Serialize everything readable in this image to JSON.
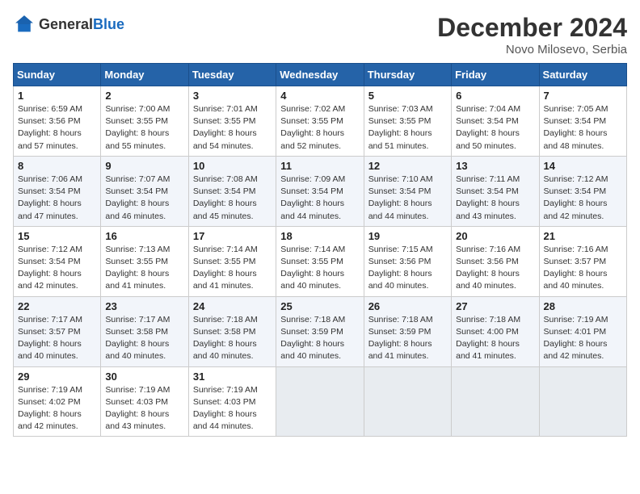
{
  "header": {
    "logo_general": "General",
    "logo_blue": "Blue",
    "month": "December 2024",
    "location": "Novo Milosevo, Serbia"
  },
  "weekdays": [
    "Sunday",
    "Monday",
    "Tuesday",
    "Wednesday",
    "Thursday",
    "Friday",
    "Saturday"
  ],
  "weeks": [
    [
      {
        "day": "1",
        "info": "Sunrise: 6:59 AM\nSunset: 3:56 PM\nDaylight: 8 hours\nand 57 minutes."
      },
      {
        "day": "2",
        "info": "Sunrise: 7:00 AM\nSunset: 3:55 PM\nDaylight: 8 hours\nand 55 minutes."
      },
      {
        "day": "3",
        "info": "Sunrise: 7:01 AM\nSunset: 3:55 PM\nDaylight: 8 hours\nand 54 minutes."
      },
      {
        "day": "4",
        "info": "Sunrise: 7:02 AM\nSunset: 3:55 PM\nDaylight: 8 hours\nand 52 minutes."
      },
      {
        "day": "5",
        "info": "Sunrise: 7:03 AM\nSunset: 3:55 PM\nDaylight: 8 hours\nand 51 minutes."
      },
      {
        "day": "6",
        "info": "Sunrise: 7:04 AM\nSunset: 3:54 PM\nDaylight: 8 hours\nand 50 minutes."
      },
      {
        "day": "7",
        "info": "Sunrise: 7:05 AM\nSunset: 3:54 PM\nDaylight: 8 hours\nand 48 minutes."
      }
    ],
    [
      {
        "day": "8",
        "info": "Sunrise: 7:06 AM\nSunset: 3:54 PM\nDaylight: 8 hours\nand 47 minutes."
      },
      {
        "day": "9",
        "info": "Sunrise: 7:07 AM\nSunset: 3:54 PM\nDaylight: 8 hours\nand 46 minutes."
      },
      {
        "day": "10",
        "info": "Sunrise: 7:08 AM\nSunset: 3:54 PM\nDaylight: 8 hours\nand 45 minutes."
      },
      {
        "day": "11",
        "info": "Sunrise: 7:09 AM\nSunset: 3:54 PM\nDaylight: 8 hours\nand 44 minutes."
      },
      {
        "day": "12",
        "info": "Sunrise: 7:10 AM\nSunset: 3:54 PM\nDaylight: 8 hours\nand 44 minutes."
      },
      {
        "day": "13",
        "info": "Sunrise: 7:11 AM\nSunset: 3:54 PM\nDaylight: 8 hours\nand 43 minutes."
      },
      {
        "day": "14",
        "info": "Sunrise: 7:12 AM\nSunset: 3:54 PM\nDaylight: 8 hours\nand 42 minutes."
      }
    ],
    [
      {
        "day": "15",
        "info": "Sunrise: 7:12 AM\nSunset: 3:54 PM\nDaylight: 8 hours\nand 42 minutes."
      },
      {
        "day": "16",
        "info": "Sunrise: 7:13 AM\nSunset: 3:55 PM\nDaylight: 8 hours\nand 41 minutes."
      },
      {
        "day": "17",
        "info": "Sunrise: 7:14 AM\nSunset: 3:55 PM\nDaylight: 8 hours\nand 41 minutes."
      },
      {
        "day": "18",
        "info": "Sunrise: 7:14 AM\nSunset: 3:55 PM\nDaylight: 8 hours\nand 40 minutes."
      },
      {
        "day": "19",
        "info": "Sunrise: 7:15 AM\nSunset: 3:56 PM\nDaylight: 8 hours\nand 40 minutes."
      },
      {
        "day": "20",
        "info": "Sunrise: 7:16 AM\nSunset: 3:56 PM\nDaylight: 8 hours\nand 40 minutes."
      },
      {
        "day": "21",
        "info": "Sunrise: 7:16 AM\nSunset: 3:57 PM\nDaylight: 8 hours\nand 40 minutes."
      }
    ],
    [
      {
        "day": "22",
        "info": "Sunrise: 7:17 AM\nSunset: 3:57 PM\nDaylight: 8 hours\nand 40 minutes."
      },
      {
        "day": "23",
        "info": "Sunrise: 7:17 AM\nSunset: 3:58 PM\nDaylight: 8 hours\nand 40 minutes."
      },
      {
        "day": "24",
        "info": "Sunrise: 7:18 AM\nSunset: 3:58 PM\nDaylight: 8 hours\nand 40 minutes."
      },
      {
        "day": "25",
        "info": "Sunrise: 7:18 AM\nSunset: 3:59 PM\nDaylight: 8 hours\nand 40 minutes."
      },
      {
        "day": "26",
        "info": "Sunrise: 7:18 AM\nSunset: 3:59 PM\nDaylight: 8 hours\nand 41 minutes."
      },
      {
        "day": "27",
        "info": "Sunrise: 7:18 AM\nSunset: 4:00 PM\nDaylight: 8 hours\nand 41 minutes."
      },
      {
        "day": "28",
        "info": "Sunrise: 7:19 AM\nSunset: 4:01 PM\nDaylight: 8 hours\nand 42 minutes."
      }
    ],
    [
      {
        "day": "29",
        "info": "Sunrise: 7:19 AM\nSunset: 4:02 PM\nDaylight: 8 hours\nand 42 minutes."
      },
      {
        "day": "30",
        "info": "Sunrise: 7:19 AM\nSunset: 4:03 PM\nDaylight: 8 hours\nand 43 minutes."
      },
      {
        "day": "31",
        "info": "Sunrise: 7:19 AM\nSunset: 4:03 PM\nDaylight: 8 hours\nand 44 minutes."
      },
      {
        "day": "",
        "info": ""
      },
      {
        "day": "",
        "info": ""
      },
      {
        "day": "",
        "info": ""
      },
      {
        "day": "",
        "info": ""
      }
    ]
  ]
}
